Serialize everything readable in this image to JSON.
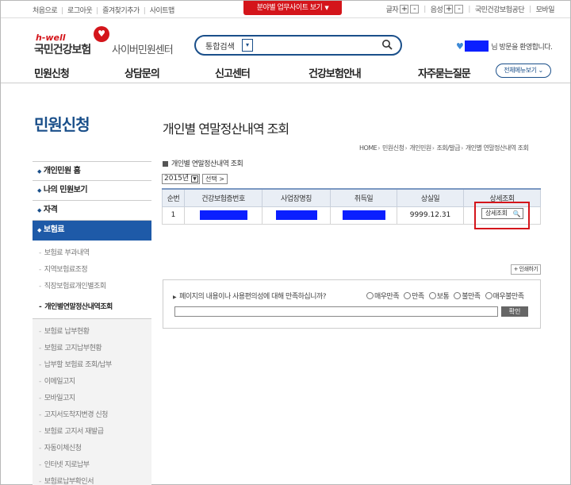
{
  "util": {
    "left_links": [
      "처음으로",
      "로그아웃",
      "즐겨찾기추가",
      "사이트맵"
    ],
    "promo": "분야별 업무사이트 보기",
    "font_label": "글자",
    "volume_label": "음성",
    "plus": "+",
    "minus": "-",
    "org": "국민건강보험공단",
    "mobile": "모바일"
  },
  "header": {
    "logo_hwell": "h-well",
    "logo_main": "국민건강보험",
    "logo_sub": "사이버민원센터",
    "search_label": "통합검색",
    "welcome_text": "님 방문을 환영합니다."
  },
  "nav": {
    "items": [
      "민원신청",
      "상담문의",
      "신고센터",
      "건강보험안내",
      "자주묻는질문"
    ],
    "all_menu": "전체메뉴보기"
  },
  "sidebar": {
    "title": "민원신청",
    "items": [
      "개인민원 홈",
      "나의 민원보기",
      "자격",
      "보험료"
    ],
    "sub_items_1": [
      "보험료 부과내역",
      "지역보험료조정",
      "직장보험료개인별조회",
      "개인별연말정산내역조회"
    ],
    "sub_items_2": [
      "보험료 납부현황",
      "보험료 고지납부현황",
      "납부할 보험료 조회/납부",
      "이메일고지",
      "모바일고지",
      "고지서도착지변경 신청",
      "보험료 고지서 재발급",
      "자동이체신청",
      "인터넷 지로납부",
      "보험료납부확인서"
    ]
  },
  "content": {
    "page_title": "개인별 연말정산내역 조회",
    "breadcrumb": [
      "HOME",
      "민원신청",
      "개인민원",
      "조회/발급",
      "개인별 연말정산내역 조회"
    ],
    "section_title": "개인별 연말정산내역 조회",
    "year": "2015년",
    "select_btn": "선택 >",
    "table": {
      "headers": [
        "순번",
        "건강보험증번호",
        "사업장명칭",
        "취득일",
        "상실일",
        "상세조회"
      ],
      "row": {
        "no": "1",
        "loss_date": "9999.12.31",
        "detail_btn": "상세조회"
      }
    },
    "print_btn": "+ 인쇄하기",
    "survey": {
      "question": "페이지의 내용이나 사용편의성에 대해 만족하십니까?",
      "options": [
        "매우만족",
        "만족",
        "보통",
        "불만족",
        "매우불만족"
      ],
      "ok": "확인"
    }
  }
}
